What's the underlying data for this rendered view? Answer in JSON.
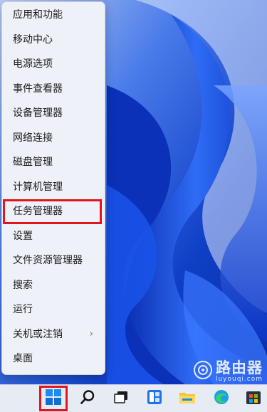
{
  "menu": {
    "items": [
      {
        "label": "应用和功能"
      },
      {
        "label": "移动中心"
      },
      {
        "label": "电源选项"
      },
      {
        "label": "事件查看器"
      },
      {
        "label": "设备管理器"
      },
      {
        "label": "网络连接"
      },
      {
        "label": "磁盘管理"
      },
      {
        "label": "计算机管理"
      },
      {
        "label": "任务管理器"
      },
      {
        "label": "设置"
      },
      {
        "label": "文件资源管理器"
      },
      {
        "label": "搜索"
      },
      {
        "label": "运行"
      },
      {
        "label": "关机或注销"
      },
      {
        "label": "桌面"
      }
    ],
    "shutdown_chevron": "›"
  },
  "taskbar": {
    "icons": [
      "windows-start-icon",
      "search-icon",
      "task-view-icon",
      "widgets-icon",
      "file-explorer-icon",
      "edge-icon",
      "store-icon"
    ]
  },
  "watermark": {
    "text_cn": "路由器",
    "text_en": "luyouqi.com"
  },
  "colors": {
    "highlight_box": "#e3141a",
    "wallpaper_blue": "#1242c8",
    "menu_bg": "#eef1f8"
  }
}
